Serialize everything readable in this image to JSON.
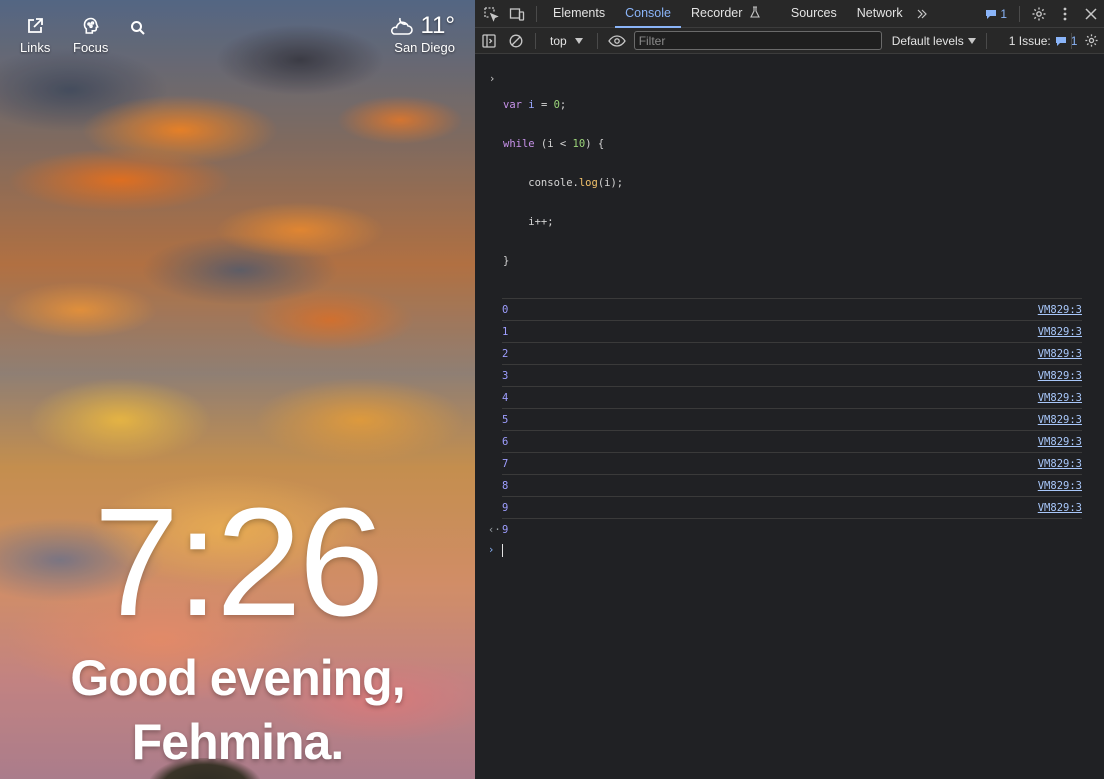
{
  "dashboard": {
    "links_label": "Links",
    "focus_label": "Focus",
    "weather": {
      "temp": "11°",
      "city": "San Diego",
      "icon": "cloud-moon-icon"
    },
    "clock": "7:26",
    "greeting_line1": "Good evening,",
    "greeting_line2": "Fehmina."
  },
  "devtools": {
    "tabs": [
      "Elements",
      "Console",
      "Recorder",
      "Sources",
      "Network"
    ],
    "active_tab": "Console",
    "issues_badge_count": "1",
    "context": "top",
    "filter_placeholder": "Filter",
    "levels_label": "Default levels",
    "issues_label": "1 Issue:",
    "issues_count": "1",
    "code_lines": [
      "var i = 0;",
      "while (i < 10) {",
      "    console.log(i);",
      "    i++;",
      "}"
    ],
    "logs": [
      {
        "value": "0",
        "source": "VM829:3"
      },
      {
        "value": "1",
        "source": "VM829:3"
      },
      {
        "value": "2",
        "source": "VM829:3"
      },
      {
        "value": "3",
        "source": "VM829:3"
      },
      {
        "value": "4",
        "source": "VM829:3"
      },
      {
        "value": "5",
        "source": "VM829:3"
      },
      {
        "value": "6",
        "source": "VM829:3"
      },
      {
        "value": "7",
        "source": "VM829:3"
      },
      {
        "value": "8",
        "source": "VM829:3"
      },
      {
        "value": "9",
        "source": "VM829:3"
      }
    ],
    "result": "9"
  },
  "colors": {
    "accent": "#8ab4f8",
    "console_number": "#9e9eff",
    "panel_bg": "#202124"
  }
}
